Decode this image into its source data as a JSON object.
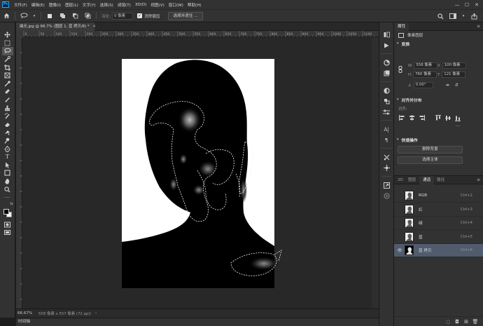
{
  "app": {
    "logo": "Ps"
  },
  "menu": [
    "文件(F)",
    "编辑(E)",
    "图像(I)",
    "图层(L)",
    "文字(Y)",
    "选择(S)",
    "滤镜(T)",
    "3D(D)",
    "视图(V)",
    "窗口(W)",
    "帮助(H)"
  ],
  "window_controls": {
    "minimize": "—",
    "maximize": "☐",
    "close": "✕"
  },
  "options": {
    "feather_label": "羽化:",
    "feather_value": "0 像素",
    "antialias_label": "消除锯齿",
    "select_mask_button": "选择并遮住 ..."
  },
  "document": {
    "tab_title": "曲光.jpg @ 66.7% (图层 1, 蓝 拷贝/8) *",
    "zoom": "66.67%",
    "info": "558 像素 x 557 像素 (72 ppi)",
    "ruler_labels": [
      "0",
      "50",
      "100",
      "150",
      "200",
      "250",
      "300",
      "350",
      "400",
      "450",
      "500",
      "550",
      "600",
      "650",
      "700",
      "750",
      "800",
      "850",
      "900",
      "950",
      "1000",
      "1050",
      "1100"
    ]
  },
  "timeline": {
    "label": "时间轴"
  },
  "properties": {
    "tab": "属性",
    "kind": "像素图层",
    "transform_title": "变换",
    "w_label": "W",
    "w_value": "558 像素",
    "h_label": "H",
    "h_value": "760 像素",
    "x_label": "X",
    "x_value": "100 像素",
    "y_label": "Y",
    "y_value": "121 像素",
    "angle_value": "0.00°",
    "align_title": "对齐并分布",
    "align_label": "对齐:",
    "quick_title": "快速操作",
    "remove_bg_button": "删除背景",
    "select_subject_button": "选择主体"
  },
  "channels_panel": {
    "tabs": [
      "3D",
      "图层",
      "通道",
      "路径"
    ],
    "active_tab": "通道",
    "rows": [
      {
        "name": "RGB",
        "shortcut": "Ctrl+2",
        "visible": false,
        "selected": false
      },
      {
        "name": "红",
        "shortcut": "Ctrl+3",
        "visible": false,
        "selected": false
      },
      {
        "name": "绿",
        "shortcut": "Ctrl+4",
        "visible": false,
        "selected": false
      },
      {
        "name": "蓝",
        "shortcut": "Ctrl+5",
        "visible": false,
        "selected": false
      },
      {
        "name": "蓝 拷贝",
        "shortcut": "Ctrl+6",
        "visible": true,
        "selected": true
      }
    ]
  },
  "colors": {
    "foreground": "#000000",
    "background": "#ffffff",
    "selection_row": "#505b6e"
  }
}
